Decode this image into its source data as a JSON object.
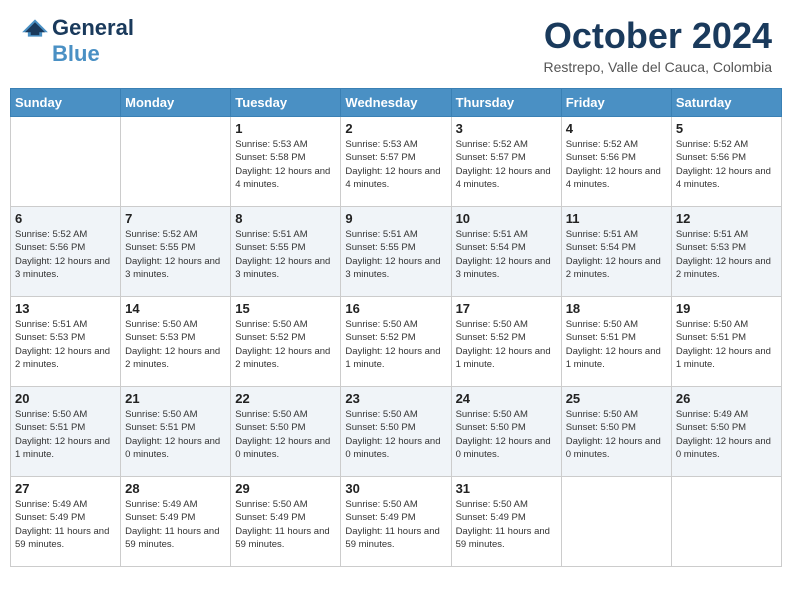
{
  "header": {
    "logo_general": "General",
    "logo_blue": "Blue",
    "month_title": "October 2024",
    "location": "Restrepo, Valle del Cauca, Colombia"
  },
  "days_of_week": [
    "Sunday",
    "Monday",
    "Tuesday",
    "Wednesday",
    "Thursday",
    "Friday",
    "Saturday"
  ],
  "weeks": [
    [
      {
        "day": "",
        "info": ""
      },
      {
        "day": "",
        "info": ""
      },
      {
        "day": "1",
        "info": "Sunrise: 5:53 AM\nSunset: 5:58 PM\nDaylight: 12 hours and 4 minutes."
      },
      {
        "day": "2",
        "info": "Sunrise: 5:53 AM\nSunset: 5:57 PM\nDaylight: 12 hours and 4 minutes."
      },
      {
        "day": "3",
        "info": "Sunrise: 5:52 AM\nSunset: 5:57 PM\nDaylight: 12 hours and 4 minutes."
      },
      {
        "day": "4",
        "info": "Sunrise: 5:52 AM\nSunset: 5:56 PM\nDaylight: 12 hours and 4 minutes."
      },
      {
        "day": "5",
        "info": "Sunrise: 5:52 AM\nSunset: 5:56 PM\nDaylight: 12 hours and 4 minutes."
      }
    ],
    [
      {
        "day": "6",
        "info": "Sunrise: 5:52 AM\nSunset: 5:56 PM\nDaylight: 12 hours and 3 minutes."
      },
      {
        "day": "7",
        "info": "Sunrise: 5:52 AM\nSunset: 5:55 PM\nDaylight: 12 hours and 3 minutes."
      },
      {
        "day": "8",
        "info": "Sunrise: 5:51 AM\nSunset: 5:55 PM\nDaylight: 12 hours and 3 minutes."
      },
      {
        "day": "9",
        "info": "Sunrise: 5:51 AM\nSunset: 5:55 PM\nDaylight: 12 hours and 3 minutes."
      },
      {
        "day": "10",
        "info": "Sunrise: 5:51 AM\nSunset: 5:54 PM\nDaylight: 12 hours and 3 minutes."
      },
      {
        "day": "11",
        "info": "Sunrise: 5:51 AM\nSunset: 5:54 PM\nDaylight: 12 hours and 2 minutes."
      },
      {
        "day": "12",
        "info": "Sunrise: 5:51 AM\nSunset: 5:53 PM\nDaylight: 12 hours and 2 minutes."
      }
    ],
    [
      {
        "day": "13",
        "info": "Sunrise: 5:51 AM\nSunset: 5:53 PM\nDaylight: 12 hours and 2 minutes."
      },
      {
        "day": "14",
        "info": "Sunrise: 5:50 AM\nSunset: 5:53 PM\nDaylight: 12 hours and 2 minutes."
      },
      {
        "day": "15",
        "info": "Sunrise: 5:50 AM\nSunset: 5:52 PM\nDaylight: 12 hours and 2 minutes."
      },
      {
        "day": "16",
        "info": "Sunrise: 5:50 AM\nSunset: 5:52 PM\nDaylight: 12 hours and 1 minute."
      },
      {
        "day": "17",
        "info": "Sunrise: 5:50 AM\nSunset: 5:52 PM\nDaylight: 12 hours and 1 minute."
      },
      {
        "day": "18",
        "info": "Sunrise: 5:50 AM\nSunset: 5:51 PM\nDaylight: 12 hours and 1 minute."
      },
      {
        "day": "19",
        "info": "Sunrise: 5:50 AM\nSunset: 5:51 PM\nDaylight: 12 hours and 1 minute."
      }
    ],
    [
      {
        "day": "20",
        "info": "Sunrise: 5:50 AM\nSunset: 5:51 PM\nDaylight: 12 hours and 1 minute."
      },
      {
        "day": "21",
        "info": "Sunrise: 5:50 AM\nSunset: 5:51 PM\nDaylight: 12 hours and 0 minutes."
      },
      {
        "day": "22",
        "info": "Sunrise: 5:50 AM\nSunset: 5:50 PM\nDaylight: 12 hours and 0 minutes."
      },
      {
        "day": "23",
        "info": "Sunrise: 5:50 AM\nSunset: 5:50 PM\nDaylight: 12 hours and 0 minutes."
      },
      {
        "day": "24",
        "info": "Sunrise: 5:50 AM\nSunset: 5:50 PM\nDaylight: 12 hours and 0 minutes."
      },
      {
        "day": "25",
        "info": "Sunrise: 5:50 AM\nSunset: 5:50 PM\nDaylight: 12 hours and 0 minutes."
      },
      {
        "day": "26",
        "info": "Sunrise: 5:49 AM\nSunset: 5:50 PM\nDaylight: 12 hours and 0 minutes."
      }
    ],
    [
      {
        "day": "27",
        "info": "Sunrise: 5:49 AM\nSunset: 5:49 PM\nDaylight: 11 hours and 59 minutes."
      },
      {
        "day": "28",
        "info": "Sunrise: 5:49 AM\nSunset: 5:49 PM\nDaylight: 11 hours and 59 minutes."
      },
      {
        "day": "29",
        "info": "Sunrise: 5:50 AM\nSunset: 5:49 PM\nDaylight: 11 hours and 59 minutes."
      },
      {
        "day": "30",
        "info": "Sunrise: 5:50 AM\nSunset: 5:49 PM\nDaylight: 11 hours and 59 minutes."
      },
      {
        "day": "31",
        "info": "Sunrise: 5:50 AM\nSunset: 5:49 PM\nDaylight: 11 hours and 59 minutes."
      },
      {
        "day": "",
        "info": ""
      },
      {
        "day": "",
        "info": ""
      }
    ]
  ]
}
